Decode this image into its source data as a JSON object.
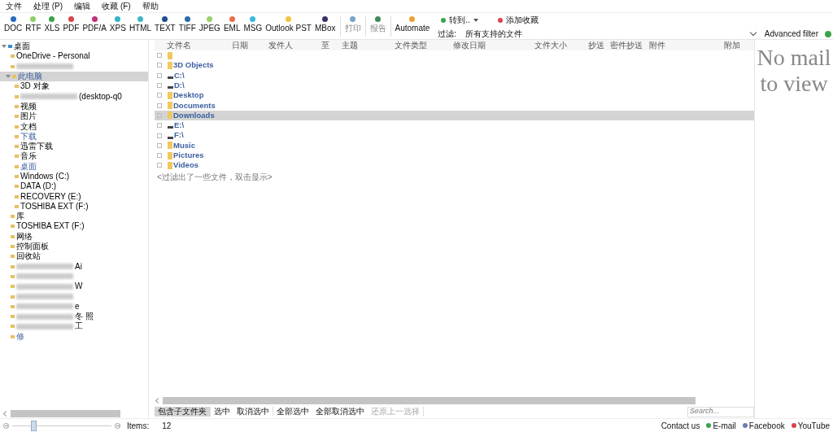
{
  "menu": [
    "文件",
    "处理 (P)",
    "编辑",
    "收藏 (F)",
    "帮助"
  ],
  "toolbar": [
    {
      "label": "DOC",
      "color": "#2a6cc0",
      "kind": "export"
    },
    {
      "label": "RTF",
      "color": "#8fcf6b",
      "kind": "export"
    },
    {
      "label": "XLS",
      "color": "#3aa34a",
      "kind": "export"
    },
    {
      "label": "PDF",
      "color": "#d9434a",
      "kind": "export"
    },
    {
      "label": "PDF/A",
      "color": "#c2307a",
      "kind": "export"
    },
    {
      "label": "XPS",
      "color": "#2fb5c9",
      "kind": "export"
    },
    {
      "label": "HTML",
      "color": "#3fb6c8",
      "kind": "export"
    },
    {
      "label": "TEXT",
      "color": "#1e4f8f",
      "kind": "export"
    },
    {
      "label": "TIFF",
      "color": "#2a6aa8",
      "kind": "export"
    },
    {
      "label": "JPEG",
      "color": "#9ad068",
      "kind": "export"
    },
    {
      "label": "EML",
      "color": "#e8704a",
      "kind": "export"
    },
    {
      "label": "MSG",
      "color": "#3cb8e0",
      "kind": "export"
    },
    {
      "label": "Outlook PST",
      "color": "#f2c43e",
      "kind": "export"
    },
    {
      "label": "MBox",
      "color": "#3c2f6e",
      "kind": "export"
    },
    {
      "label": "打印",
      "color": "#7aa3c8",
      "kind": "muted"
    },
    {
      "label": "报告",
      "color": "#3a8a5a",
      "kind": "muted"
    },
    {
      "label": "Automate",
      "color": "#f0a030",
      "kind": "export"
    }
  ],
  "goto": {
    "label": "转到..",
    "color": "#3aa34a"
  },
  "favorite": {
    "label": "添加收藏",
    "color": "#d9434a"
  },
  "filter": {
    "label": "过滤:",
    "value": "所有支持的文件",
    "advanced": "Advanced filter"
  },
  "tree": [
    {
      "label": "桌面",
      "highlighted": false,
      "selected": false,
      "expanded": true,
      "children": [
        {
          "label": "OneDrive - Personal",
          "highlighted": false,
          "selected": false
        },
        {
          "redacted": true,
          "selected": false
        },
        {
          "label": "此电脑",
          "highlighted": true,
          "selected": true,
          "expanded": true,
          "children": [
            {
              "label": "3D 对象",
              "highlighted": false,
              "selected": false
            },
            {
              "label": "(desktop-q0",
              "redacted": true,
              "highlighted": false,
              "selected": false
            },
            {
              "label": "视频",
              "highlighted": false,
              "selected": false
            },
            {
              "label": "图片",
              "highlighted": false,
              "selected": false
            },
            {
              "label": "文档",
              "highlighted": false,
              "selected": false
            },
            {
              "label": "下载",
              "highlighted": true,
              "selected": false
            },
            {
              "label": "迅雷下载",
              "highlighted": false,
              "selected": false
            },
            {
              "label": "音乐",
              "highlighted": false,
              "selected": false
            },
            {
              "label": "桌面",
              "highlighted": true,
              "selected": false
            },
            {
              "label": "Windows (C:)",
              "highlighted": false,
              "selected": false
            },
            {
              "label": "DATA (D:)",
              "highlighted": false,
              "selected": false
            },
            {
              "label": "RECOVERY (E:)",
              "highlighted": false,
              "selected": false
            },
            {
              "label": "TOSHIBA EXT (F:)",
              "highlighted": false,
              "selected": false
            }
          ]
        },
        {
          "label": "库",
          "highlighted": false,
          "selected": false
        },
        {
          "label": "TOSHIBA EXT (F:)",
          "highlighted": false,
          "selected": false
        },
        {
          "label": "网络",
          "highlighted": false,
          "selected": false
        },
        {
          "label": "控制面板",
          "highlighted": false,
          "selected": false
        },
        {
          "label": "回收站",
          "highlighted": false,
          "selected": false
        },
        {
          "label": "Ai",
          "redacted": true,
          "highlighted": false,
          "selected": false
        },
        {
          "redacted": true,
          "selected": false
        },
        {
          "label": "W",
          "redacted": true,
          "highlighted": false,
          "selected": false
        },
        {
          "redacted": true,
          "selected": false
        },
        {
          "label": "e",
          "redacted": true,
          "highlighted": false,
          "selected": false
        },
        {
          "label": "冬 照",
          "redacted": true,
          "highlighted": false,
          "selected": false
        },
        {
          "label": "工",
          "redacted": true,
          "highlighted": false,
          "selected": false
        },
        {
          "label": "修",
          "highlighted": true,
          "selected": false
        }
      ]
    }
  ],
  "columns": [
    "文件名",
    "日期",
    "发件人",
    "至",
    "主题",
    "文件类型",
    "修改日期",
    "文件大小",
    "抄送",
    "密件抄送",
    "附件",
    "附加"
  ],
  "files": [
    {
      "kind": "folder",
      "selected": false
    },
    {
      "name": "3D Objects",
      "kind": "folder",
      "selected": false
    },
    {
      "name": "C:\\",
      "kind": "drive",
      "selected": false
    },
    {
      "name": "D:\\",
      "kind": "drive",
      "selected": false
    },
    {
      "name": "Desktop",
      "kind": "folder",
      "selected": false
    },
    {
      "name": "Documents",
      "kind": "folder",
      "selected": false
    },
    {
      "name": "Downloads",
      "kind": "folder",
      "selected": true
    },
    {
      "name": "E:\\",
      "kind": "drive",
      "selected": false
    },
    {
      "name": "F:\\",
      "kind": "drive",
      "selected": false
    },
    {
      "name": "Music",
      "kind": "folder",
      "selected": false
    },
    {
      "name": "Pictures",
      "kind": "folder",
      "selected": false
    },
    {
      "name": "Videos",
      "kind": "folder",
      "selected": false
    }
  ],
  "filtered_note": "<过滤出了一些文件，双击显示>",
  "preview": {
    "message": "No mail to view"
  },
  "selection_buttons": [
    {
      "label": "包含子文件夹",
      "pressed": true,
      "disabled": false
    },
    {
      "label": "选中",
      "pressed": false,
      "disabled": false
    },
    {
      "label": "取消选中",
      "pressed": false,
      "disabled": false
    },
    {
      "label": "全部选中",
      "pressed": false,
      "disabled": false
    },
    {
      "label": "全部取消选中",
      "pressed": false,
      "disabled": false
    },
    {
      "label": "还原上一选择",
      "pressed": false,
      "disabled": true
    }
  ],
  "search": {
    "placeholder": "Search..."
  },
  "zoom": {
    "level": 0.22
  },
  "items": {
    "label": "Items:",
    "count": "12"
  },
  "links": [
    {
      "label": "Contact us",
      "kind": "plain"
    },
    {
      "label": "E-mail",
      "kind": "icon",
      "color": "#3aa34a"
    },
    {
      "label": "Facebook",
      "kind": "icon",
      "color": "#6a7fb0"
    },
    {
      "label": "YouTube",
      "kind": "icon",
      "color": "#d9434a"
    }
  ]
}
